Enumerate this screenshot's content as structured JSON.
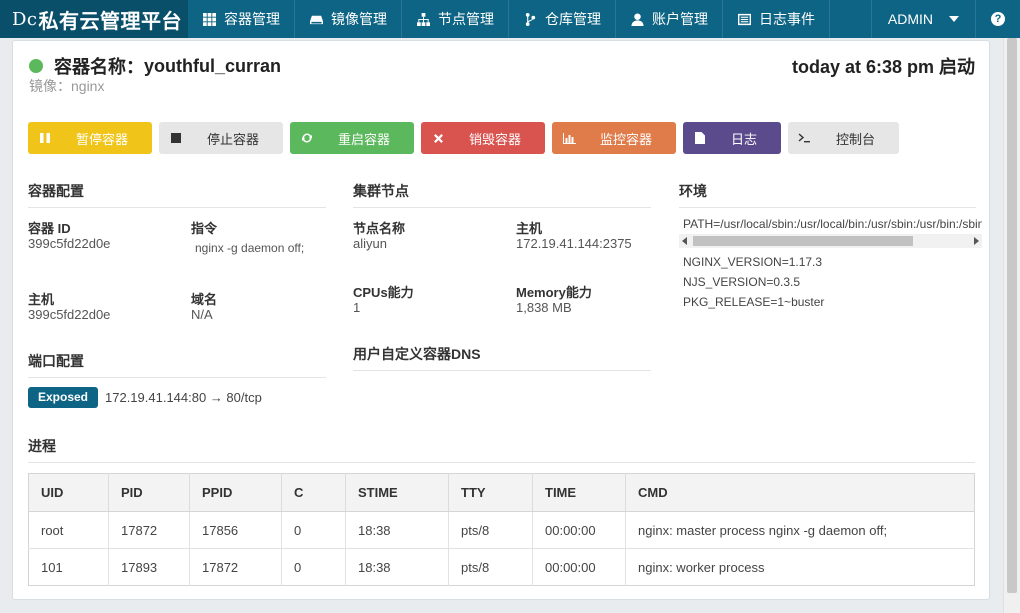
{
  "brand": {
    "logo_prefix": "Dc",
    "title": "私有云管理平台"
  },
  "nav": {
    "items": [
      {
        "label": "容器管理",
        "icon": "grid-icon"
      },
      {
        "label": "镜像管理",
        "icon": "drive-icon"
      },
      {
        "label": "节点管理",
        "icon": "sitemap-icon"
      },
      {
        "label": "仓库管理",
        "icon": "branch-icon"
      },
      {
        "label": "账户管理",
        "icon": "user-icon"
      },
      {
        "label": "日志事件",
        "icon": "list-icon"
      }
    ],
    "user": "ADMIN",
    "help": "?"
  },
  "container": {
    "title_label": "容器名称：",
    "name": "youthful_curran",
    "image_line": "镜像：nginx",
    "started": "today at 6:38 pm 启动",
    "status_color": "#5cb85c"
  },
  "actions": {
    "pause": "暂停容器",
    "stop": "停止容器",
    "restart": "重启容器",
    "destroy": "销毁容器",
    "monitor": "监控容器",
    "logs": "日志",
    "console": "控制台"
  },
  "config": {
    "section": "容器配置",
    "id_label": "容器 ID",
    "id_value": "399c5fd22d0e",
    "cmd_label": "指令",
    "cmd_value": "nginx -g daemon off;",
    "host_label": "主机",
    "host_value": "399c5fd22d0e",
    "domain_label": "域名",
    "domain_value": "N/A"
  },
  "cluster": {
    "section": "集群节点",
    "node_label": "节点名称",
    "node_value": "aliyun",
    "host_label": "主机",
    "host_value": "172.19.41.144:2375",
    "cpu_label": "CPUs能力",
    "cpu_value": "1",
    "mem_label": "Memory能力",
    "mem_value": "1,838 MB",
    "dns_section": "用户自定义容器DNS"
  },
  "env": {
    "section": "环境",
    "path": "PATH=/usr/local/sbin:/usr/local/bin:/usr/sbin:/usr/bin:/sbin:/bin",
    "vars": [
      "NGINX_VERSION=1.17.3",
      "NJS_VERSION=0.3.5",
      "PKG_RELEASE=1~buster"
    ]
  },
  "ports": {
    "section": "端口配置",
    "badge": "Exposed",
    "mapping": "172.19.41.144:80 → 80/tcp"
  },
  "process": {
    "section": "进程",
    "columns": [
      "UID",
      "PID",
      "PPID",
      "C",
      "STIME",
      "TTY",
      "TIME",
      "CMD"
    ],
    "rows": [
      [
        "root",
        "17872",
        "17856",
        "0",
        "18:38",
        "pts/8",
        "00:00:00",
        "nginx: master process nginx -g daemon off;"
      ],
      [
        "101",
        "17893",
        "17872",
        "0",
        "18:38",
        "pts/8",
        "00:00:00",
        "nginx: worker process"
      ]
    ]
  }
}
